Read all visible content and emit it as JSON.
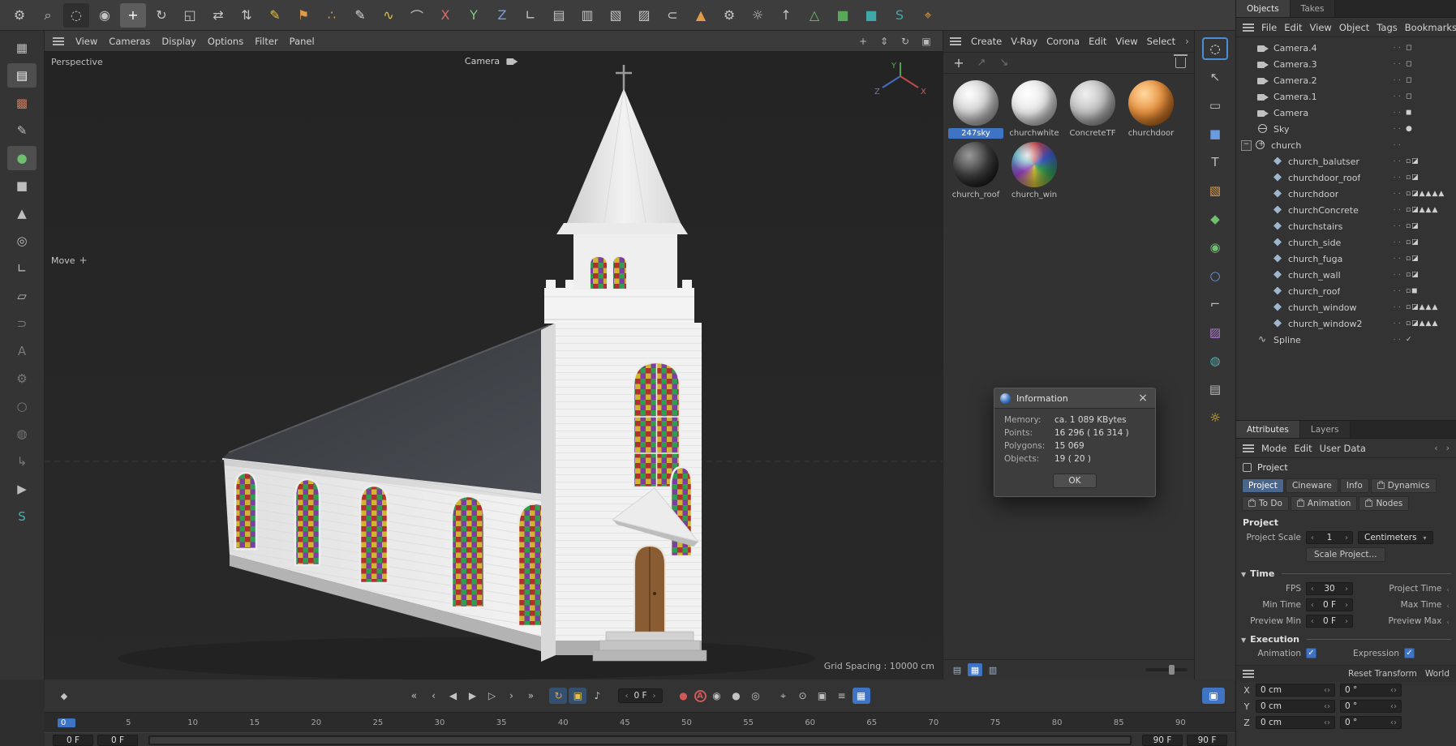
{
  "topbar": {
    "tools": [
      {
        "name": "app-settings-gear-icon",
        "glyph": "⚙"
      },
      {
        "name": "zoom-tool",
        "glyph": "⌕"
      },
      {
        "name": "live-selection-tool",
        "glyph": "◌",
        "pressed": true
      },
      {
        "name": "rectangle-selection-tool",
        "glyph": "◉"
      },
      {
        "name": "move-tool",
        "glyph": "+",
        "active": true
      },
      {
        "name": "rotate-tool",
        "glyph": "↻"
      },
      {
        "name": "scale-tool",
        "glyph": "◱"
      },
      {
        "name": "x-move-tool",
        "glyph": "⇄"
      },
      {
        "name": "y-move-tool",
        "glyph": "⇅"
      },
      {
        "name": "spline-pen-tool",
        "glyph": "✎",
        "color": "#e3c14e"
      },
      {
        "name": "spline-flag-tool",
        "glyph": "⚑",
        "color": "#e09a4a"
      },
      {
        "name": "spline-point-tool",
        "glyph": "∴",
        "color": "#e09a4a"
      },
      {
        "name": "sketch-tool",
        "glyph": "✎",
        "color": "#d8d8d8"
      },
      {
        "name": "spline-smooth-tool",
        "glyph": "∿",
        "color": "#e3c14e"
      },
      {
        "name": "spline-arc-tool",
        "glyph": "⌒"
      },
      {
        "name": "x-axis-toggle",
        "glyph": "X",
        "color": "#d96a6a"
      },
      {
        "name": "y-axis-toggle",
        "glyph": "Y",
        "color": "#7dc87d"
      },
      {
        "name": "z-axis-toggle",
        "glyph": "Z",
        "color": "#7a9ce0"
      },
      {
        "name": "coordinate-system-toggle",
        "glyph": "∟"
      },
      {
        "name": "make-editable-icon",
        "glyph": "▤"
      },
      {
        "name": "workplane-icon",
        "glyph": "▥"
      },
      {
        "name": "modeling-icon-1",
        "glyph": "▧"
      },
      {
        "name": "modeling-icon-2",
        "glyph": "▨"
      },
      {
        "name": "snap-magnet-icon",
        "glyph": "⊂"
      },
      {
        "name": "falloff-icon",
        "glyph": "▲",
        "color": "#e09a4a"
      },
      {
        "name": "modeling-settings-icon",
        "glyph": "⚙"
      },
      {
        "name": "highlight-icon",
        "glyph": "☼"
      },
      {
        "name": "workplane-up-icon",
        "glyph": "↑"
      },
      {
        "name": "volume-icon",
        "glyph": "△",
        "color": "#6fbf6f"
      },
      {
        "name": "volume-mesh-icon",
        "glyph": "■",
        "color": "#5aa85a"
      },
      {
        "name": "remesh-icon",
        "glyph": "■",
        "color": "#3fa8a8"
      },
      {
        "name": "spline-s-icon",
        "glyph": "S",
        "color": "#3fa8a8"
      },
      {
        "name": "pose-pin-icon",
        "glyph": "⌖",
        "color": "#e09a4a"
      }
    ]
  },
  "leftbar": {
    "tools": [
      {
        "name": "array-grid-icon",
        "glyph": "▦"
      },
      {
        "name": "snapshot-grid-icon",
        "glyph": "▤",
        "active": true
      },
      {
        "name": "render-region-icon",
        "glyph": "▩",
        "color": "#c87a5a"
      },
      {
        "name": "sketch-pen-icon",
        "glyph": "✎"
      },
      {
        "name": "model-mode-icon",
        "glyph": "●",
        "color": "#6fbf6f",
        "active": true
      },
      {
        "name": "object-mode-icon",
        "glyph": "■"
      },
      {
        "name": "point-mode-icon",
        "glyph": "▲"
      },
      {
        "name": "ring-mode-icon",
        "glyph": "◎"
      },
      {
        "name": "edge-mode-icon",
        "glyph": "∟"
      },
      {
        "name": "polygon-mode-icon",
        "glyph": "▱"
      },
      {
        "name": "hook-icon",
        "glyph": "⊃",
        "dim": true
      },
      {
        "name": "text-kerning-icon",
        "glyph": "A",
        "dim": true
      },
      {
        "name": "modeling-gear-icon",
        "glyph": "⚙",
        "dim": true
      },
      {
        "name": "circle-icon",
        "glyph": "○",
        "dim": true
      },
      {
        "name": "sphere-icon",
        "glyph": "◍",
        "dim": true
      },
      {
        "name": "redirect-arrow-icon",
        "glyph": "↳",
        "dim": true
      },
      {
        "name": "play-icon",
        "glyph": "▶"
      },
      {
        "name": "spline-s-icon",
        "glyph": "S",
        "color": "#4ab0b0"
      }
    ]
  },
  "viewport": {
    "menu": [
      "View",
      "Cameras",
      "Display",
      "Options",
      "Filter",
      "Panel"
    ],
    "nav_icons": [
      {
        "name": "pan-view-icon",
        "glyph": "+"
      },
      {
        "name": "dolly-view-icon",
        "glyph": "⇕"
      },
      {
        "name": "orbit-view-icon",
        "glyph": "↻"
      },
      {
        "name": "toggle-views-icon",
        "glyph": "▣"
      }
    ],
    "perspective_label": "Perspective",
    "camera_label": "Camera",
    "move_label": "Move",
    "grid_spacing": "Grid Spacing : 10000 cm",
    "axis": {
      "x": "X",
      "y": "Y",
      "z": "Z"
    }
  },
  "materials": {
    "menu": [
      "Create",
      "V-Ray",
      "Corona",
      "Edit",
      "View",
      "Select"
    ],
    "items": [
      {
        "name": "247sky",
        "selected": true,
        "grad": "radial-gradient(circle at 35% 30%, #ffffff 0%, #d8d8d8 40%, #8f8f8f 82%)"
      },
      {
        "name": "churchwhite",
        "grad": "radial-gradient(circle at 35% 30%, #ffffff 0%, #e8e8e8 45%, #9a9a9a 85%)"
      },
      {
        "name": "ConcreteTF",
        "grad": "radial-gradient(circle at 35% 30%, #f0f0f0 0%, #c2c2c2 45%, #787878 85%)"
      },
      {
        "name": "churchdoor",
        "grad": "radial-gradient(circle at 35% 30%, #ffd9a0 0%, #e8913f 45%, #9c5513 85%)"
      },
      {
        "name": "church_roof",
        "grad": "radial-gradient(circle at 35% 30%, #9a9a9a 0%, #3f3f3f 45%, #111111 85%)"
      },
      {
        "name": "church_win",
        "grad": "radial-gradient(circle at 35% 30%, rgba(255,255,255,0.85) 0%, rgba(255,255,255,0) 38%), conic-gradient(#c23a3a, #3a55c2, #35a055, #d0bb35, #8a3ab0, #3aa0b0, #c23a3a)"
      }
    ],
    "footer_icons": [
      {
        "name": "list-view-icon",
        "glyph": "▤"
      },
      {
        "name": "grid-view-icon",
        "glyph": "▦",
        "on_blue": true
      },
      {
        "name": "detail-view-icon",
        "glyph": "▥"
      }
    ]
  },
  "info_dialog": {
    "title": "Information",
    "rows": [
      {
        "label": "Memory:",
        "value": "ca. 1 089 KBytes"
      },
      {
        "label": "Points:",
        "value": "16 296 ( 16 314 )"
      },
      {
        "label": "Polygons:",
        "value": "15 069"
      },
      {
        "label": "Objects:",
        "value": "19 ( 20 )"
      }
    ],
    "ok_label": "OK"
  },
  "rightstrip": {
    "tools": [
      {
        "name": "live-selection-icon",
        "glyph": "◌",
        "active": true
      },
      {
        "name": "cursor-select-icon",
        "glyph": "↖"
      },
      {
        "name": "marquee-select-icon",
        "glyph": "▭"
      },
      {
        "name": "cube-primitive-icon",
        "glyph": "■",
        "color": "#6a9ae0"
      },
      {
        "name": "text-primitive-icon",
        "glyph": "T"
      },
      {
        "name": "paint-tool-icon",
        "glyph": "▧",
        "color": "#e09a4a"
      },
      {
        "name": "volume-box-icon",
        "glyph": "◆",
        "color": "#6fbf6f"
      },
      {
        "name": "generator-icon",
        "glyph": "◉",
        "color": "#6fbf6f"
      },
      {
        "name": "sphere-primitive-icon",
        "glyph": "○",
        "color": "#6a9ae0"
      },
      {
        "name": "axis-tool-icon",
        "glyph": "⌐"
      },
      {
        "name": "deformer-icon",
        "glyph": "▨",
        "color": "#b07ad0"
      },
      {
        "name": "environment-icon",
        "glyph": "◍",
        "color": "#4ab0b0"
      },
      {
        "name": "render-settings-icon",
        "glyph": "▤"
      },
      {
        "name": "light-icon",
        "glyph": "☼",
        "color": "#e3c14e"
      }
    ]
  },
  "object_manager": {
    "tab_objects": "Objects",
    "tab_takes": "Takes",
    "menu": [
      "File",
      "Edit",
      "View",
      "Object",
      "Tags",
      "Bookmarks"
    ],
    "items": [
      {
        "label": "Camera.4",
        "cls": "cam",
        "ind": "8px",
        "exp": "",
        "tags": "◻"
      },
      {
        "label": "Camera.3",
        "cls": "cam",
        "ind": "8px",
        "exp": "",
        "tags": "◻"
      },
      {
        "label": "Camera.2",
        "cls": "cam",
        "ind": "8px",
        "exp": "",
        "tags": "◻"
      },
      {
        "label": "Camera.1",
        "cls": "cam",
        "ind": "8px",
        "exp": "",
        "tags": "◻"
      },
      {
        "label": "Camera",
        "cls": "cam",
        "ind": "8px",
        "exp": "",
        "tags": "◼"
      },
      {
        "label": "Sky",
        "cls": "sky",
        "ind": "8px",
        "exp": "",
        "tags": "●"
      },
      {
        "label": "church",
        "cls": "null",
        "ind": "2px",
        "exp": "−",
        "tags": ""
      },
      {
        "label": "church_balutser",
        "cls": "mesh",
        "ind": "26px",
        "exp": "",
        "tags": "▫◪"
      },
      {
        "label": "churchdoor_roof",
        "cls": "mesh",
        "ind": "26px",
        "exp": "",
        "tags": "▫◪"
      },
      {
        "label": "churchdoor",
        "cls": "mesh",
        "ind": "26px",
        "exp": "",
        "tags": "▫◪▲▲▲▲"
      },
      {
        "label": "churchConcrete",
        "cls": "mesh",
        "ind": "26px",
        "exp": "",
        "tags": "▫◪▲▲▲"
      },
      {
        "label": "churchstairs",
        "cls": "mesh",
        "ind": "26px",
        "exp": "",
        "tags": "▫◪"
      },
      {
        "label": "church_side",
        "cls": "mesh",
        "ind": "26px",
        "exp": "",
        "tags": "▫◪"
      },
      {
        "label": "church_fuga",
        "cls": "mesh",
        "ind": "26px",
        "exp": "",
        "tags": "▫◪"
      },
      {
        "label": "church_wall",
        "cls": "mesh",
        "ind": "26px",
        "exp": "",
        "tags": "▫◪"
      },
      {
        "label": "church_roof",
        "cls": "mesh",
        "ind": "26px",
        "exp": "",
        "tags": "▫◼"
      },
      {
        "label": "church_window",
        "cls": "mesh",
        "ind": "26px",
        "exp": "",
        "tags": "▫◪▲▲▲"
      },
      {
        "label": "church_window2",
        "cls": "mesh",
        "ind": "26px",
        "exp": "",
        "tags": "▫◪▲▲▲"
      },
      {
        "label": "Spline",
        "cls": "spline",
        "ind": "8px",
        "exp": "",
        "tags": "✓"
      }
    ]
  },
  "attributes": {
    "tab_attributes": "Attributes",
    "tab_layers": "Layers",
    "menu": [
      "Mode",
      "Edit",
      "User Data"
    ],
    "object_title": "Project",
    "tabs_row1": [
      {
        "label": "Project",
        "active": true
      },
      {
        "label": "Cineware"
      },
      {
        "label": "Info"
      },
      {
        "label": "Dynamics",
        "lock": true
      }
    ],
    "tabs_row2": [
      {
        "label": "To Do",
        "lock": true
      },
      {
        "label": "Animation",
        "lock": true
      },
      {
        "label": "Nodes",
        "lock": true
      }
    ],
    "section_project": "Project",
    "project_scale": {
      "label": "Project Scale",
      "value": "1",
      "unit": "Centimeters"
    },
    "scale_project_button": "Scale Project...",
    "section_time": "Time",
    "rows": [
      {
        "label": "FPS",
        "value": "30",
        "right_label": "Project Time"
      },
      {
        "label": "Min Time",
        "value": "0 F",
        "right_label": "Max Time"
      },
      {
        "label": "Preview Min",
        "value": "0 F",
        "right_label": "Preview Max"
      }
    ],
    "section_execution": "Execution",
    "execution": {
      "animation_label": "Animation",
      "animation_checked": true,
      "expression_label": "Expression",
      "expression_checked": true
    },
    "coord_header": {
      "reset": "Reset Transform",
      "world": "World"
    },
    "coords": [
      {
        "axis": "X",
        "pos": "0 cm",
        "rot": "0 °"
      },
      {
        "axis": "Y",
        "pos": "0 cm",
        "rot": "0 °"
      },
      {
        "axis": "Z",
        "pos": "0 cm",
        "rot": "0 °"
      }
    ]
  },
  "timeline": {
    "key_nav": {
      "glyph": "◆"
    },
    "transport": [
      {
        "name": "goto-start-button",
        "glyph": "«"
      },
      {
        "name": "prev-key-button",
        "glyph": "‹"
      },
      {
        "name": "prev-frame-button",
        "glyph": "◀"
      },
      {
        "name": "play-button",
        "glyph": "▶"
      },
      {
        "name": "next-frame-button",
        "glyph": "▷"
      },
      {
        "name": "next-key-button",
        "glyph": "›"
      },
      {
        "name": "goto-end-button",
        "glyph": "»"
      }
    ],
    "toggles": [
      {
        "name": "loop-toggle",
        "glyph": "↻",
        "on": true,
        "color": "#e0a050"
      },
      {
        "name": "autokey-region-toggle",
        "glyph": "▣",
        "on": true,
        "color": "#e0c050"
      },
      {
        "name": "sound-toggle",
        "glyph": "♪"
      }
    ],
    "frame_field": {
      "value": "0 F"
    },
    "record": [
      {
        "name": "record-button",
        "glyph": "●",
        "color": "#d05858"
      },
      {
        "name": "autokey-button",
        "glyph": "A",
        "ring": true,
        "color": "#d05858"
      },
      {
        "name": "key-interpolation-button",
        "glyph": "◉"
      },
      {
        "name": "key-position-button",
        "glyph": "●"
      },
      {
        "name": "key-rotation-button",
        "glyph": "◎"
      }
    ],
    "extras": [
      {
        "name": "snap-button",
        "glyph": "⌖"
      },
      {
        "name": "center-button",
        "glyph": "⊙"
      },
      {
        "name": "frame-all-button",
        "glyph": "▣"
      },
      {
        "name": "options-button",
        "glyph": "≡"
      },
      {
        "name": "minimal-mode-button",
        "glyph": "▦",
        "on_blue": true
      }
    ],
    "expand_button": {
      "glyph": "▣"
    },
    "ticks": [
      {
        "t": "0",
        "cur": true
      },
      {
        "t": "5"
      },
      {
        "t": "10"
      },
      {
        "t": "15"
      },
      {
        "t": "20"
      },
      {
        "t": "25"
      },
      {
        "t": "30"
      },
      {
        "t": "35"
      },
      {
        "t": "40"
      },
      {
        "t": "45"
      },
      {
        "t": "50"
      },
      {
        "t": "55"
      },
      {
        "t": "60"
      },
      {
        "t": "65"
      },
      {
        "t": "70"
      },
      {
        "t": "75"
      },
      {
        "t": "80"
      },
      {
        "t": "85"
      },
      {
        "t": "90"
      }
    ],
    "range": {
      "start": "0 F",
      "start2": "0 F",
      "end": "90 F",
      "end2": "90 F"
    }
  }
}
